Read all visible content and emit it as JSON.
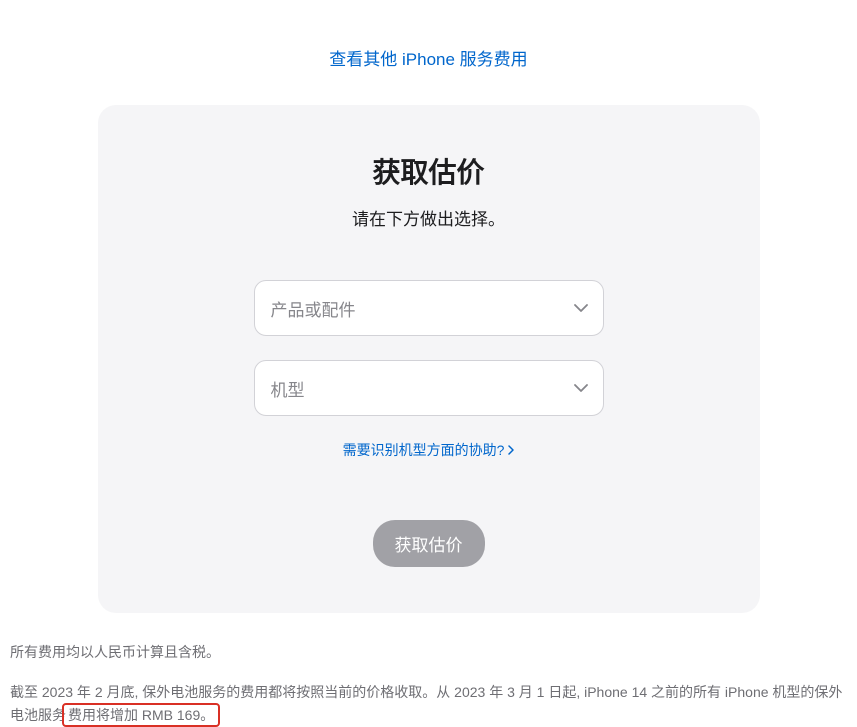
{
  "topLink": {
    "text": "查看其他 iPhone 服务费用"
  },
  "card": {
    "title": "获取估价",
    "subtitle": "请在下方做出选择。",
    "select1": {
      "placeholder": "产品或配件"
    },
    "select2": {
      "placeholder": "机型"
    },
    "helpLink": {
      "text": "需要识别机型方面的协助?"
    },
    "submitButton": {
      "label": "获取估价"
    }
  },
  "footnotes": {
    "line1": "所有费用均以人民币计算且含税。",
    "line2_part1": "截至 2023 年 2 月底, 保外电池服务的费用都将按照当前的价格收取。从 2023 年 3 月 1 日起, iPhone 14 之前的所有 iPhone 机型的保外电池服务",
    "line2_highlight": "费用将增加 RMB 169。"
  }
}
